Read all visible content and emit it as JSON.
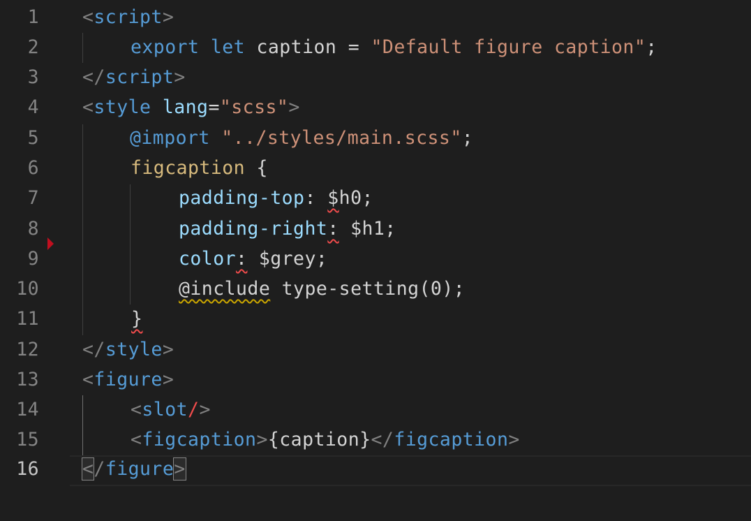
{
  "editor": {
    "line_numbers": [
      "1",
      "2",
      "3",
      "4",
      "5",
      "6",
      "7",
      "8",
      "9",
      "10",
      "11",
      "12",
      "13",
      "14",
      "15",
      "16"
    ],
    "active_line": "16"
  },
  "code": {
    "l1": {
      "open": "<",
      "tag": "script",
      "close": ">"
    },
    "l2": {
      "kw1": "export",
      "kw2": "let",
      "name": "caption",
      "eq": " = ",
      "str": "\"Default figure caption\"",
      "semi": ";"
    },
    "l3": {
      "open": "</",
      "tag": "script",
      "close": ">"
    },
    "l4": {
      "open": "<",
      "tag": "style",
      "attr": "lang",
      "eq": "=",
      "val": "\"scss\"",
      "close": ">"
    },
    "l5": {
      "at": "@import",
      "str": "\"../styles/main.scss\"",
      "semi": ";"
    },
    "l6": {
      "sel": "figcaption",
      "brace": " {"
    },
    "l7": {
      "prop": "padding-top",
      "colon": ":",
      "sp": " ",
      "dollar": "$",
      "val": "h0",
      "semi": ";"
    },
    "l8": {
      "prop": "padding-right",
      "colon": ":",
      "val": " $h1;"
    },
    "l9": {
      "prop": "color",
      "colon": ":",
      "val": " $grey;"
    },
    "l10": {
      "at": "@include",
      "val": " type-setting(0);"
    },
    "l11": {
      "brace": "}"
    },
    "l12": {
      "open": "</",
      "tag": "style",
      "close": ">"
    },
    "l13": {
      "open": "<",
      "tag": "figure",
      "close": ">"
    },
    "l14": {
      "open": "<",
      "tag": "slot",
      "slash": "/",
      "close": ">"
    },
    "l15": {
      "open": "<",
      "tag": "figcaption",
      "close": ">",
      "expr": "{caption}",
      "open2": "</",
      "tag2": "figcaption",
      "close2": ">"
    },
    "l16": {
      "lt": "<",
      "slash": "/",
      "tag": "figure",
      "gt": ">"
    }
  },
  "colors": {
    "background": "#1e1e1e",
    "tag": "#569cd6",
    "string": "#ce9178",
    "property": "#9cdcfe",
    "selector": "#d7ba7d",
    "punctuation": "#808080",
    "error": "#f14c4c",
    "warning": "#cca700"
  }
}
